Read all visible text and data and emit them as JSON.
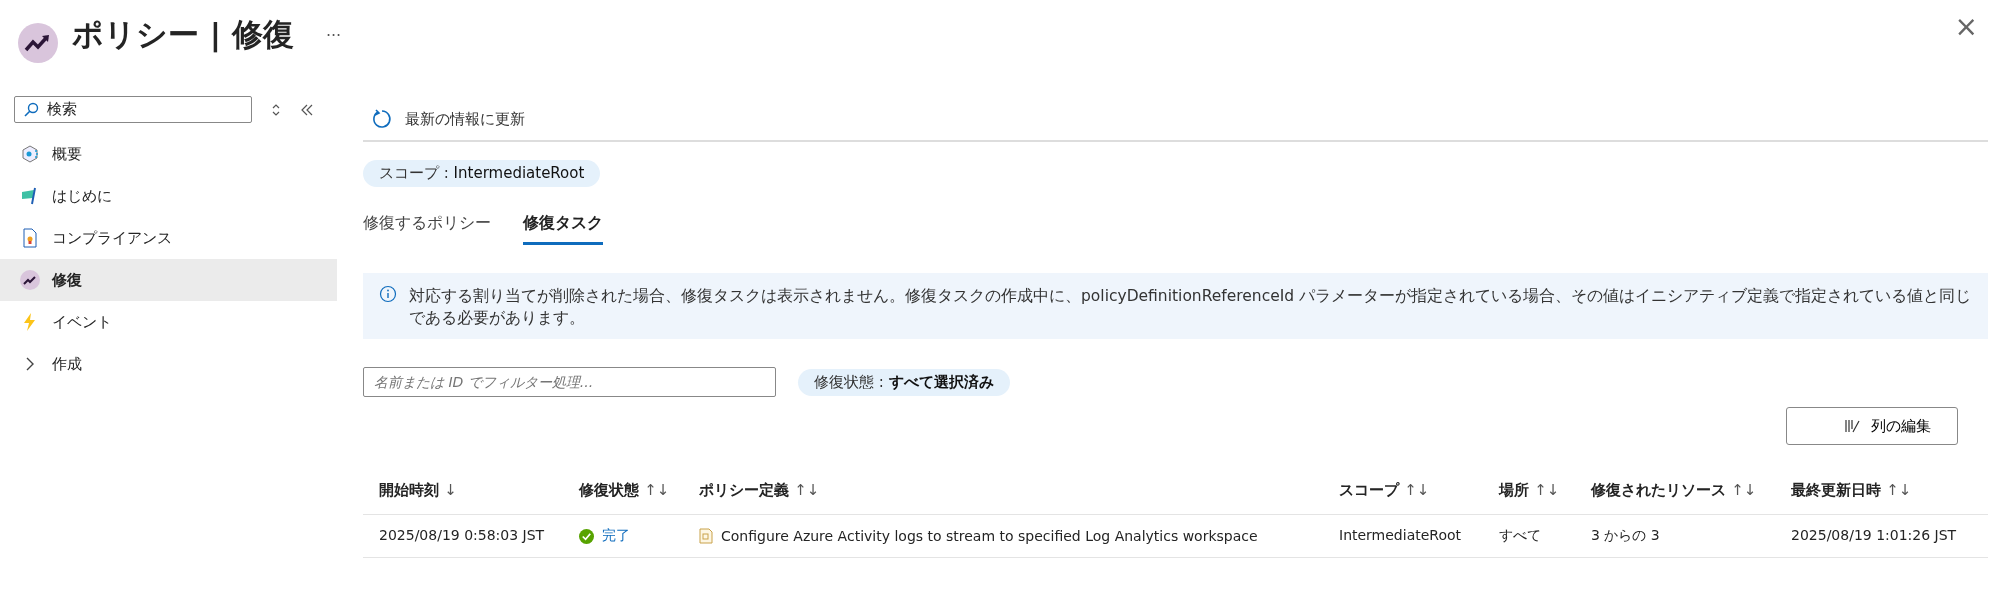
{
  "header": {
    "title": "ポリシー | 修復",
    "more": "···",
    "close": "×"
  },
  "sidebar": {
    "search": {
      "value": "検索"
    },
    "items": [
      {
        "label": "概要",
        "selected": false
      },
      {
        "label": "はじめに",
        "selected": false
      },
      {
        "label": "コンプライアンス",
        "selected": false
      },
      {
        "label": "修復",
        "selected": true
      },
      {
        "label": "イベント",
        "selected": false
      },
      {
        "label": "作成",
        "selected": false,
        "expanded": false
      }
    ]
  },
  "toolbar": {
    "refresh": "最新の情報に更新"
  },
  "scope_chip": {
    "label": "スコープ : ",
    "value": "IntermediateRoot"
  },
  "tabs": [
    {
      "label": "修復するポリシー",
      "selected": false
    },
    {
      "label": "修復タスク",
      "selected": true
    }
  ],
  "info": "対応する割り当てが削除された場合、修復タスクは表示されません。修復タスクの作成中に、policyDefinitionReferenceId パラメーターが指定されている場合、その値はイニシアティブ定義で指定されている値と同じである必要があります。",
  "filter": {
    "placeholder": "名前または ID でフィルター処理..."
  },
  "status_chip": {
    "label": "修復状態 : ",
    "value": "すべて選択済み"
  },
  "edit_columns": "列の編集",
  "table": {
    "columns": [
      {
        "label": "開始時刻",
        "sort": "↓"
      },
      {
        "label": "修復状態",
        "sort": "↑↓"
      },
      {
        "label": "ポリシー定義",
        "sort": "↑↓"
      },
      {
        "label": "スコープ",
        "sort": "↑↓"
      },
      {
        "label": "場所",
        "sort": "↑↓"
      },
      {
        "label": "修復されたリソース",
        "sort": "↑↓"
      },
      {
        "label": "最終更新日時",
        "sort": "↑↓"
      }
    ],
    "rows": [
      {
        "start": "2025/08/19 0:58:03 JST",
        "status": "完了",
        "policy": "Configure Azure Activity logs to stream to specified Log Analytics workspace",
        "scope": "IntermediateRoot",
        "location": "すべて",
        "resources": "3 からの 3",
        "updated": "2025/08/19 1:01:26 JST"
      }
    ]
  }
}
